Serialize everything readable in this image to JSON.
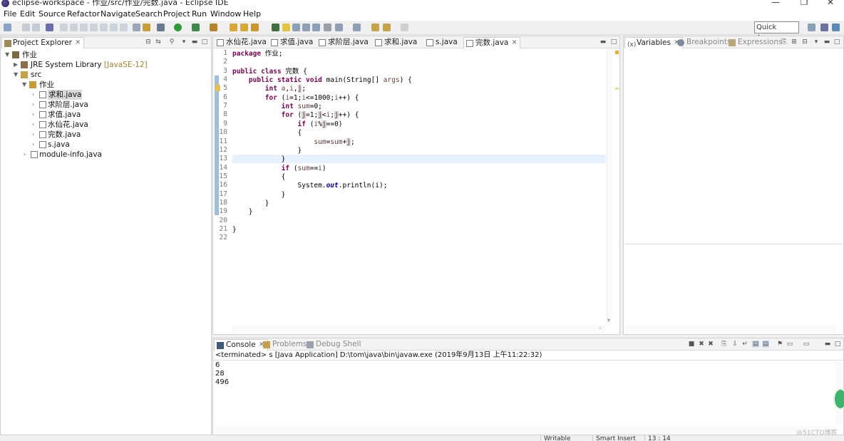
{
  "window": {
    "title": "eclipse-workspace - 作业/src/作业/完数.java - Eclipse IDE",
    "controls": [
      "—",
      "❐",
      "✕"
    ]
  },
  "menu": [
    "File",
    "Edit",
    "Source",
    "Refactor",
    "Navigate",
    "Search",
    "Project",
    "Run",
    "Window",
    "Help"
  ],
  "toolbar": {
    "quick_access": "Quick Access"
  },
  "project_explorer": {
    "title": "Project Explorer",
    "tree": {
      "project": "作业",
      "jre": "JRE System Library",
      "jre_decor": "[JavaSE-12]",
      "src": "src",
      "package": "作业",
      "files": [
        "求和.java",
        "求阶层.java",
        "求值.java",
        "水仙花.java",
        "完数.java",
        "s.java"
      ],
      "module": "module-info.java"
    }
  },
  "editor": {
    "tabs": [
      "水仙花.java",
      "求值.java",
      "求阶层.java",
      "求和.java",
      "s.java",
      "完数.java"
    ],
    "active_tab": "完数.java",
    "line_numbers": [
      "1",
      "2",
      "3",
      "4",
      "5",
      "6",
      "7",
      "8",
      "9",
      "10",
      "11",
      "12",
      "13",
      "14",
      "15",
      "16",
      "17",
      "18",
      "19",
      "20",
      "21",
      "22"
    ]
  },
  "code": [
    "package 作业;",
    "",
    "public class 完数 {",
    "    public static void main(String[] args) {",
    "        int a,i,j;",
    "        for (i=1;i<=1000;i++) {",
    "            int sum=0;",
    "            for (j=1;j<i;j++) {",
    "                if (i%j==0)",
    "                {",
    "                    sum=sum+j;",
    "                }",
    "            }",
    "            if (sum==i)",
    "            {",
    "                System.out.println(i);",
    "            }",
    "        }",
    "    }",
    "",
    "}",
    ""
  ],
  "right_panel": {
    "tabs": [
      "Variables",
      "Breakpoints",
      "Expressions"
    ]
  },
  "bottom_panel": {
    "tabs": [
      "Console",
      "Problems",
      "Debug Shell"
    ],
    "terminated": "<terminated> s [Java Application] D:\\tom\\java\\bin\\javaw.exe (2019年9月13日 上午11:22:32)",
    "output": [
      "6",
      "28",
      "496"
    ]
  },
  "statusbar": {
    "writable": "Writable",
    "insert_mode": "Smart Insert",
    "position": "13 : 14"
  },
  "watermark": "@51CTO博客",
  "colors": {
    "keyword": "#7f0055",
    "local_var": "#6a3e3e",
    "static_field": "#0000c0",
    "line_highlight": "#e8f2fe",
    "change_ruler": "#9ebcdc"
  }
}
